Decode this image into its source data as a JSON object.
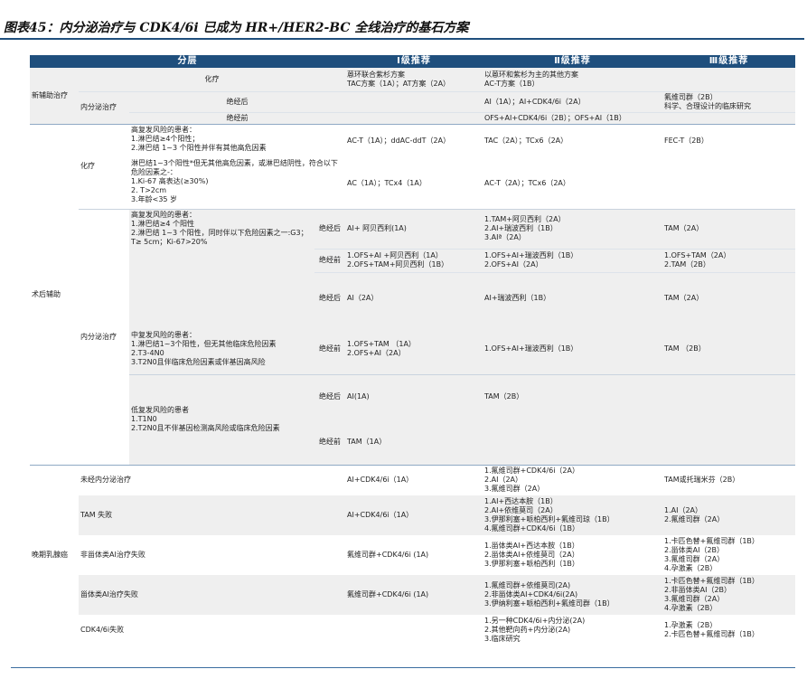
{
  "title": "图表45：内分泌治疗与 CDK4/6i 已成为 HR+/HER2-BC 全线治疗的基石方案",
  "header": {
    "col_layer": "分层",
    "col_i": "Ⅰ级推荐",
    "col_ii": "Ⅱ级推荐",
    "col_iii": "Ⅲ级推荐"
  },
  "neo": {
    "label": "新辅助治疗",
    "chemo": {
      "label": "化疗",
      "i": "蒽环联合紫杉方案\nTAC方案（1A）；AT方案（2A）",
      "ii": "以蒽环和紫杉为主的其他方案\nAC-T方案（1B）"
    },
    "endo": {
      "label": "内分泌治疗",
      "post_label": "绝经后",
      "post_ii": "AI（1A）；AI+CDK4/6i（2A）",
      "post_iii": "氟维司群（2B）\n科学、合理设计的临床研究",
      "pre_label": "绝经前",
      "pre_ii": "OFS+AI+CDK4/6i（2B）；OFS+AI（1B）"
    }
  },
  "adj": {
    "label": "术后辅助",
    "chemo": {
      "label": "化疗",
      "desc1": "高复发风险的患者：\n1.淋巴结≥4个阳性；\n2.淋巴结 1~3 个阳性并伴有其他高危因素",
      "desc2": "淋巴结1~3个阳性*但无其他高危因素，或淋巴结阴性，符合以下危险因素之-：\n1.Ki-67 高表达(≥30%)\n2. T>2cm\n3.年龄<35 岁",
      "r1_i": "AC-T（1A）；ddAC-ddT（2A）",
      "r1_ii": "TAC（2A）；TCx6（2A）",
      "r1_iii": "FEC-T（2B）",
      "r2_i": "AC（1A）；TCx4（1A）",
      "r2_ii": "AC-T（2A）；TCx6（2A）"
    },
    "endo": {
      "label": "内分泌治疗",
      "high_desc": "高复发风险的患者：\n1.淋巴结≥4 个阳性\n2.淋巴结 1~3 个阳性，同时伴以下危险因素之一:G3；T≥ 5cm；Ki-67>20%",
      "high_post": "绝经后",
      "high_post_i": "AI+ 阿贝西利(1A)",
      "high_post_ii": "1.TAM+阿贝西利（2A）\n2.AI+瑞波西利（1B）\n3.AIª（2A）",
      "high_post_iii": "TAM（2A）",
      "high_pre": "绝经前",
      "high_pre_i": "1.OFS+AI +阿贝西利（1A）\n2.OFS+TAM+阿贝西利（1B）",
      "high_pre_ii": "1.OFS+AI+瑞波西利（1B）\n2.OFS+AI（2A）",
      "high_pre_iii": "1.OFS+TAM（2A）\n2.TAM（2B）",
      "mid_desc": "中复发风险的患者：\n1.淋巴结1~3个阳性，但无其他临床危险因素\n2.T3-4N0\n3.T2N0且伴临床危险因素或伴基因高风险",
      "mid_post": "绝经后",
      "mid_post_i": "AI（2A）",
      "mid_post_ii": "AI+瑞波西利（1B）",
      "mid_post_iii": "TAM（2A）",
      "mid_pre": "绝经前",
      "mid_pre_i": "1.OFS+TAM （1A）\n2.OFS+AI（2A）",
      "mid_pre_ii": "1.OFS+AI+瑞波西利（1B）",
      "mid_pre_iii": "TAM （2B）",
      "low_desc": "低复发风险的患者\n1.T1N0\n2.T2N0且不伴基因检测高风险或临床危险因素",
      "low_post": "绝经后",
      "low_post_i": "AI(1A)",
      "low_post_ii": "TAM（2B）",
      "low_pre": "绝经前",
      "low_pre_i": "TAM（1A）"
    }
  },
  "late": {
    "label": "晚期乳腺癌",
    "rows": [
      {
        "label": "未经内分泌治疗",
        "i": "AI+CDK4/6i（1A）",
        "ii": "1.氟维司群+CDK4/6i（2A）\n2.AI（2A）\n3.氟维司群（2A）",
        "iii": "TAM或托瑞米芬（2B）"
      },
      {
        "label": "TAM 失败",
        "i": "AI+CDK4/6i（1A）",
        "ii": "1.AI+西达本胺（1B）\n2.AI+依维莫司（2A）\n3.伊那利塞+哌柏西利+氟维司琼（1B）\n4.氟维司群+CDK4/6i（1B）",
        "iii": "1.AI（2A）\n2.氟维司群（2A）"
      },
      {
        "label": "非甾体类AI治疗失败",
        "i": "氟维司群+CDK4/6i (1A)",
        "ii": "1.甾体类AI+西达本胺（1B）\n2.甾体类AI+依维莫司（2A）\n3.伊那利塞+哌柏西利（1B）",
        "iii": "1.卡匹色替+氟维司群（1B）\n2.甾体类AI（2B）\n3.氟维司群（2A）\n4.孕激素（2B）"
      },
      {
        "label": "甾体类AI治疗失败",
        "i": "氟维司群+CDK4/6i (1A)",
        "ii": "1.氟维司群+依维莫司(2A)\n2.非甾体类AI+CDK4/6i(2A)\n3.伊纳利塞+哌柏西利+氟维司群（1B）",
        "iii": "1.卡匹色替+氟维司群（1B）\n2.非甾体类AI（2B）\n3.氟维司群（2A）\n4.孕激素（2B）"
      },
      {
        "label": "CDK4/6i失败",
        "i": "",
        "ii": "1.另一种CDK4/6i+内分泌(2A)\n2.其他靶向药+内分泌(2A)\n3.临床研究",
        "iii": "1.孕激素（2B）\n2.卡匹色替+氟维司群（1B）"
      }
    ]
  }
}
